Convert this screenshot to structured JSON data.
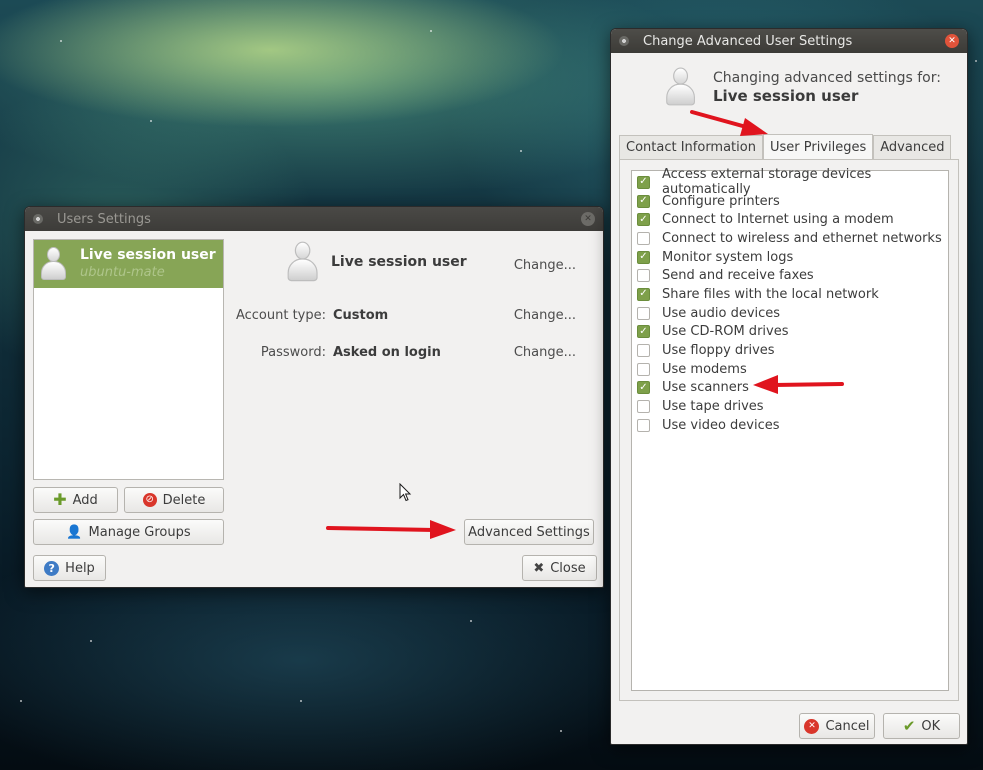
{
  "desktop": {},
  "users_window": {
    "title": "Users Settings",
    "user": {
      "full_name": "Live session user",
      "login": "ubuntu-mate"
    },
    "detail_name": "Live session user",
    "change_label": "Change...",
    "account_type_label": "Account type:",
    "account_type_value": "Custom",
    "password_label": "Password:",
    "password_value": "Asked on login",
    "buttons": {
      "add": "Add",
      "delete": "Delete",
      "manage_groups": "Manage Groups",
      "advanced_settings": "Advanced Settings",
      "help": "Help",
      "close": "Close"
    }
  },
  "advanced_window": {
    "title": "Change Advanced User Settings",
    "subtitle": "Changing advanced settings for:",
    "user_name": "Live session user",
    "tabs": [
      {
        "label": "Contact Information",
        "selected": false
      },
      {
        "label": "User Privileges",
        "selected": true
      },
      {
        "label": "Advanced",
        "selected": false
      }
    ],
    "privileges": [
      {
        "label": "Access external storage devices automatically",
        "checked": true
      },
      {
        "label": "Configure printers",
        "checked": true
      },
      {
        "label": "Connect to Internet using a modem",
        "checked": true
      },
      {
        "label": "Connect to wireless and ethernet networks",
        "checked": false
      },
      {
        "label": "Monitor system logs",
        "checked": true
      },
      {
        "label": "Send and receive faxes",
        "checked": false
      },
      {
        "label": "Share files with the local network",
        "checked": true
      },
      {
        "label": "Use audio devices",
        "checked": false
      },
      {
        "label": "Use CD-ROM drives",
        "checked": true
      },
      {
        "label": "Use floppy drives",
        "checked": false
      },
      {
        "label": "Use modems",
        "checked": false
      },
      {
        "label": "Use scanners",
        "checked": true
      },
      {
        "label": "Use tape drives",
        "checked": false
      },
      {
        "label": "Use video devices",
        "checked": false
      }
    ],
    "buttons": {
      "cancel": "Cancel",
      "ok": "OK"
    }
  },
  "colors": {
    "selection_green": "#87a556",
    "checkbox_green": "#7ea04a",
    "annotation_red": "#e0141e",
    "close_orange": "#e0533a"
  }
}
